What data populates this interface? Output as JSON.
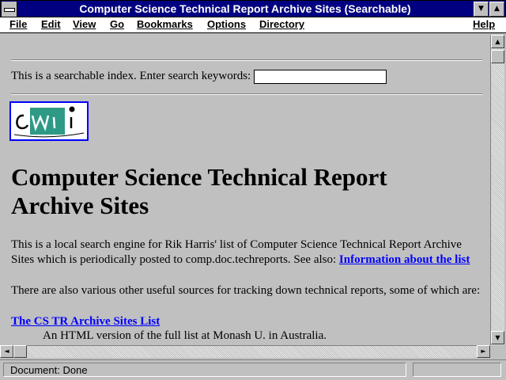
{
  "window": {
    "title": "Computer Science Technical Report Archive Sites (Searchable)",
    "minimize_glyph": "▼",
    "maximize_glyph": "▲"
  },
  "menu": {
    "items": [
      "File",
      "Edit",
      "View",
      "Go",
      "Bookmarks",
      "Options",
      "Directory"
    ],
    "help": "Help"
  },
  "search": {
    "label": "This is a searchable index. Enter search keywords:",
    "value": ""
  },
  "logo": {
    "text": "cwi",
    "icon": "cwi-logo"
  },
  "page": {
    "title": "Computer Science Technical Report Archive Sites",
    "intro_text": "This is a local search engine for Rik Harris' list of Computer Science Technical Report Archive Sites which is periodically posted to comp.doc.techreports. See also: ",
    "intro_link": "Information about the list",
    "sources_text": "There are also various other useful sources for tracking down technical reports, some of which are:",
    "list_link": "The CS TR Archive Sites List",
    "list_desc": "An HTML version of the full list at Monash U. in Australia."
  },
  "scrollbar": {
    "up": "▲",
    "down": "▼",
    "left": "◄",
    "right": "►"
  },
  "status": {
    "text": "Document: Done"
  }
}
